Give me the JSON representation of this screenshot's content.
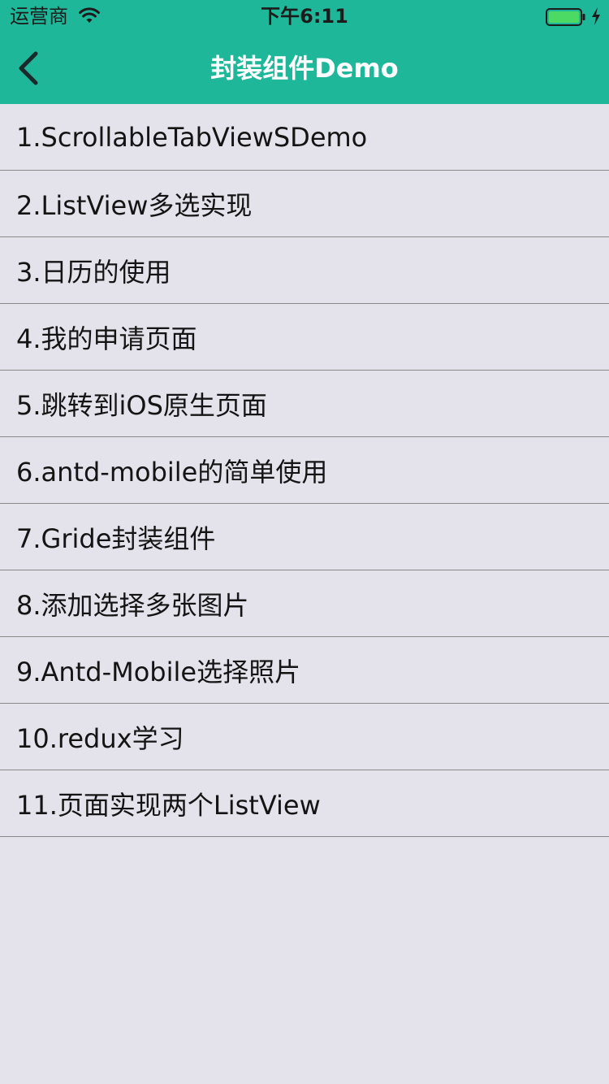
{
  "status_bar": {
    "carrier": "运营商",
    "time": "下午6:11",
    "icons": [
      "wifi-icon",
      "battery-icon",
      "charging-icon"
    ]
  },
  "nav_bar": {
    "title": "封装组件Demo",
    "back_icon": "chevron-left-icon"
  },
  "colors": {
    "accent": "#1fb79a",
    "background": "#e4e3ec",
    "divider": "#8a8a8a",
    "battery": "#4cd964"
  },
  "list": {
    "items": [
      {
        "label": "1.ScrollableTabViewSDemo"
      },
      {
        "label": "2.ListView多选实现"
      },
      {
        "label": "3.日历的使用"
      },
      {
        "label": "4.我的申请页面"
      },
      {
        "label": "5.跳转到iOS原生页面"
      },
      {
        "label": "6.antd-mobile的简单使用"
      },
      {
        "label": "7.Gride封装组件"
      },
      {
        "label": "8.添加选择多张图片"
      },
      {
        "label": "9.Antd-Mobile选择照片"
      },
      {
        "label": "10.redux学习"
      },
      {
        "label": "11.页面实现两个ListView"
      }
    ]
  }
}
